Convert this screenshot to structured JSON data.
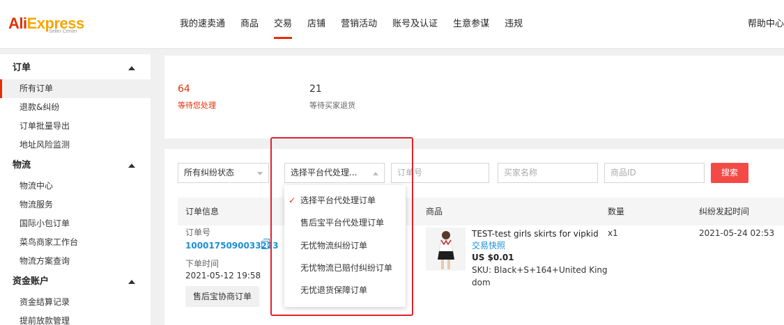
{
  "brand": {
    "name_part1": "Ali",
    "name_part2": "Express",
    "sub": "Seller Center"
  },
  "nav": {
    "items": [
      "我的速卖通",
      "商品",
      "交易",
      "店铺",
      "营销活动",
      "账号及认证",
      "生意参谋",
      "违规"
    ],
    "active": "交易",
    "help": "帮助中心"
  },
  "sidebar": {
    "sections": [
      {
        "title": "订单",
        "items": [
          "所有订单",
          "退款&纠纷",
          "订单批量导出",
          "地址风险监测"
        ]
      },
      {
        "title": "物流",
        "items": [
          "物流中心",
          "物流服务",
          "国际小包订单",
          "菜鸟商家工作台",
          "物流方案查询"
        ]
      },
      {
        "title": "资金账户",
        "items": [
          "资金结算记录",
          "提前放款管理"
        ]
      }
    ],
    "active_item": "所有订单"
  },
  "stats": [
    {
      "value": "64",
      "label": "等待您处理"
    },
    {
      "value": "21",
      "label": "等待买家退货"
    }
  ],
  "filters": {
    "status_select": "所有纠纷状态",
    "platform_select": "选择平台代处理...",
    "order_no_placeholder": "订单号",
    "buyer_placeholder": "买家名称",
    "product_id_placeholder": "商品ID",
    "search_label": "搜索"
  },
  "dropdown_options": [
    "选择平台代处理订单",
    "售后宝平台代处理订单",
    "无忧物流纠纷订单",
    "无忧物流已赔付纠纷订单",
    "无忧退货保障订单"
  ],
  "dropdown_selected": "选择平台代处理订单",
  "table": {
    "headers": [
      "订单信息",
      "商品",
      "数量",
      "纠纷发起时间"
    ],
    "row": {
      "order_label": "订单号",
      "order_no": "1000175090033223",
      "time_label": "下单时间",
      "order_time": "2021-05-12 19:58",
      "tag": "售后宝协商订单",
      "product_title": "TEST-test girls skirts for vipkid",
      "snapshot": "交易快照",
      "price": "US $0.01",
      "sku_line1": "SKU: Black+S+164+United King",
      "sku_line2": "dom",
      "quantity": "x1",
      "dispute_time": "2021-05-24 02:53"
    }
  },
  "colors": {
    "accent": "#e62e04",
    "link": "#1a8fd7",
    "search_btn": "#f44a46",
    "highlight_box": "#e0212c"
  }
}
